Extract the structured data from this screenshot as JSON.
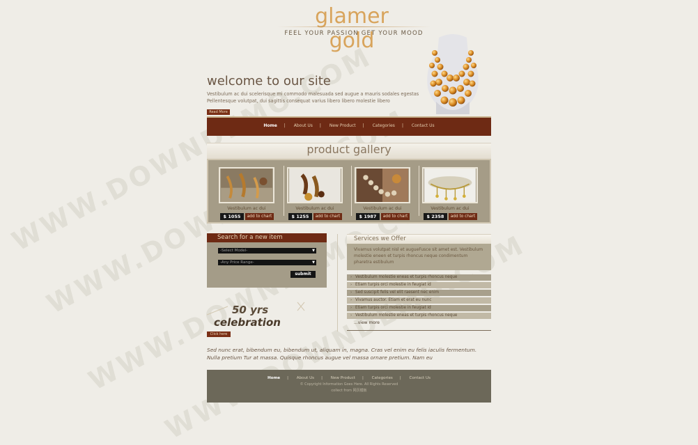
{
  "header": {
    "logo": "glamer gold",
    "tagline": "FEEL YOUR PASSION GET YOUR MOOD"
  },
  "welcome": {
    "title": "welcome to our site",
    "line1": "Vestibulum ac dui scelerisque mi commodo malesuada sed augue a mauris sodales egestas",
    "line2": "Pellentesque volutpat, dui sagittis consequat varius libero libero molestie libero",
    "read_more": "Read More"
  },
  "nav": {
    "items": [
      "Home",
      "About Us",
      "New Product",
      "Categories",
      "Contact Us"
    ],
    "separator": "|"
  },
  "gallery": {
    "title": "product gallery",
    "products": [
      {
        "caption": "Vestibulum ac dui",
        "price": "$ 1055",
        "cart": "add to chart"
      },
      {
        "caption": "Vestibulum ac dui",
        "price": "$ 1255",
        "cart": "add to chart"
      },
      {
        "caption": "Vestibulum ac dui",
        "price": "$ 1987",
        "cart": "add to chart"
      },
      {
        "caption": "Vestibulum ac dui",
        "price": "$ 2358",
        "cart": "add to chart"
      }
    ]
  },
  "search": {
    "title": "Search for a new item",
    "model_select": "-Select Model-",
    "price_select": "-Any Price Range-",
    "submit": "submit"
  },
  "celebration": {
    "years": "50 yrs",
    "word": "celebration",
    "click_here": "Click here"
  },
  "services": {
    "title": "Services we Offer",
    "intro": "Vivamus volutpat nisl et augueFusce sit amet est. Vestibulum molestie eneen et turpis rhoncus neque condimentum pharetra estibulum",
    "items": [
      "Vestibulum molestie eneas et turpis rhoncus neque",
      "Etiam turpis orci molestie in feugiat id",
      "Sed suscipit felis vel elit raesent nec enim",
      "Vivamus auctor. Etiam et erat eu nunc",
      "Etiam turpis orci molestie in feugiat id",
      "Vestibulum molestie eneas et turpis rhoncus neque"
    ],
    "view_more": "...view more"
  },
  "bottom_text": "Sed nunc erat, bibendum eu, bibendum ut, aliquam in, magna. Cras vel enim eu felis iaculis fermentum. Nulla pretium Tur at massa. Quisque rhoncus augue vel massa ornare pretium. Nam eu",
  "footer": {
    "links": [
      "Home",
      "About Us",
      "New Product",
      "Categories",
      "Contact Us"
    ],
    "copyright": "© Copyright Information Goes Here. All Rights Reserved",
    "collect": "collect from 网页模板"
  },
  "watermark": "WWW.DOWNDEMO.COM",
  "colors": {
    "background": "#efede7",
    "brand_brown": "#6e2a14",
    "gold": "#d8a45c",
    "panel_taupe": "#a59c87",
    "footer": "#6c6859"
  }
}
